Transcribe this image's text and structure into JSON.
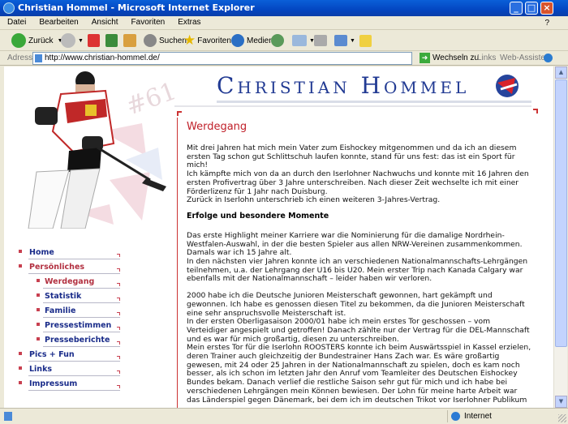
{
  "window": {
    "title": "Christian Hommel - Microsoft Internet Explorer"
  },
  "menu": [
    "Datei",
    "Bearbeiten",
    "Ansicht",
    "Favoriten",
    "Extras",
    "?"
  ],
  "toolbar": {
    "back": "Zurück",
    "search": "Suchen",
    "favorites": "Favoriten",
    "media": "Medien"
  },
  "address": {
    "label": "Adresse",
    "url": "http://www.christian-hommel.de/",
    "go": "Wechseln zu",
    "links": "Links",
    "webassistant": "Web-Assistent"
  },
  "status": {
    "zone": "Internet"
  },
  "page": {
    "site_title": "Christian Hommel",
    "jersey": "#61",
    "heading": "Werdegang",
    "p1": "Mit drei Jahren hat mich mein Vater zum Eishockey mitgenommen und da ich an diesem ersten Tag schon gut Schlittschuh laufen konnte, stand für uns fest: das ist ein Sport für mich!",
    "p2": "Ich kämpfte mich von da an durch den Iserlohner Nachwuchs und konnte mit 16 Jahren den ersten Profivertrag über 3 Jahre unterschreiben. Nach dieser Zeit wechselte ich mit einer Förderlizenz für 1 Jahr nach Duisburg.",
    "p3": "Zurück in Iserlohn unterschrieb ich einen weiteren 3-Jahres-Vertrag.",
    "subheading": "Erfolge und besondere Momente",
    "p4": "Das erste Highlight meiner Karriere war die Nominierung für die damalige Nordrhein-Westfalen-Auswahl, in der die besten Spieler aus allen NRW-Vereinen zusammenkommen. Damals war ich 15 Jahre alt.",
    "p5": "In den nächsten vier Jahren konnte ich an verschiedenen Nationalmannschafts-Lehrgängen teilnehmen, u.a. der Lehrgang der U16 bis U20. Mein erster Trip nach Kanada Calgary war ebenfalls mit der Nationalmannschaft – leider haben wir verloren.",
    "p6": "2000 habe ich die Deutsche Junioren Meisterschaft gewonnen, hart gekämpft und gewonnen. Ich habe es genossen diesen Titel zu bekommen, da die Junioren Meisterschaft eine sehr anspruchsvolle Meisterschaft ist.",
    "p7": "In der ersten Oberligasaison 2000/01 habe ich mein erstes Tor geschossen – vom Verteidiger angespielt und getroffen! Danach zählte nur der Vertrag für die DEL-Mannschaft und es war für mich großartig, diesen zu unterschreiben.",
    "p8": "Mein erstes Tor für die Iserlohn ROOSTERS konnte ich beim Auswärtsspiel in Kassel erzielen, deren Trainer auch gleichzeitig der Bundestrainer Hans Zach war. Es wäre großartig gewesen, mit 24 oder 25 Jahren in der Nationalmannschaft zu spielen, doch es kam noch besser, als ich schon im letzten Jahr den Anruf vom Teamleiter des Deutschen Eishockey Bundes bekam. Danach verlief die restliche Saison sehr gut für mich und ich habe bei verschiedenen Lehrgängen mein Können bewiesen. Der Lohn für meine harte Arbeit war das Länderspiel gegen Dänemark, bei dem ich im deutschen Trikot vor Iserlohner Publikum"
  },
  "nav": [
    {
      "label": "Home",
      "level": "top",
      "active": false
    },
    {
      "label": "Persönliches",
      "level": "top",
      "active": true
    },
    {
      "label": "Werdegang",
      "level": "sub",
      "active": true
    },
    {
      "label": "Statistik",
      "level": "sub",
      "active": false
    },
    {
      "label": "Familie",
      "level": "sub",
      "active": false
    },
    {
      "label": "Pressestimmen",
      "level": "sub",
      "active": false
    },
    {
      "label": "Presseberichte",
      "level": "sub",
      "active": false
    },
    {
      "label": "Pics + Fun",
      "level": "top",
      "active": false
    },
    {
      "label": "Links",
      "level": "top",
      "active": false
    },
    {
      "label": "Impressum",
      "level": "top",
      "active": false
    }
  ]
}
